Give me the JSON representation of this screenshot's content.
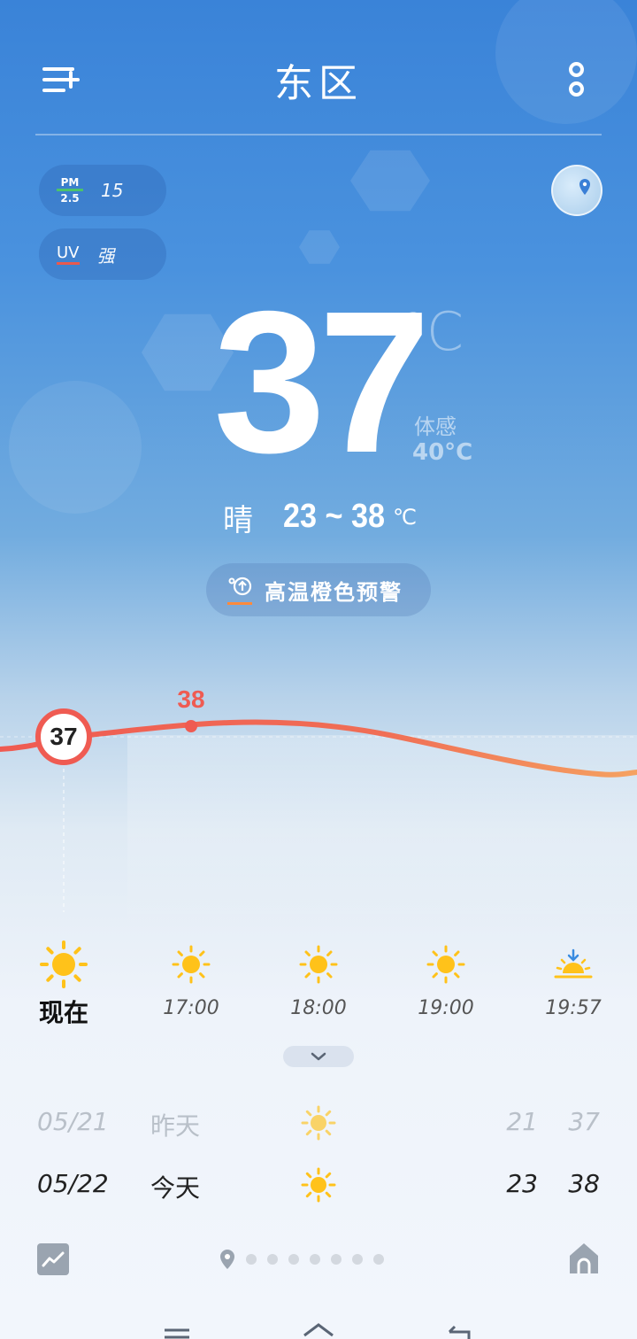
{
  "header": {
    "city": "东区",
    "menu_icon": "add-city-menu-icon",
    "more_icon": "more-options-icon"
  },
  "air": {
    "pm_label_top": "PM",
    "pm_label_bottom": "2.5",
    "pm_value": "15",
    "uv_label": "UV",
    "uv_value": "强"
  },
  "current": {
    "temperature": "37",
    "unit": "°C",
    "feels_like_label": "体感",
    "feels_like_value": "40°C",
    "condition": "晴",
    "range": "23 ~ 38",
    "range_unit": "℃"
  },
  "alert": {
    "text": "高温橙色预警",
    "color": "#ff8a3c"
  },
  "curve": {
    "now_value": "37",
    "max_value": "38",
    "line_color": "#ef5b52"
  },
  "hourly": [
    {
      "time": "现在",
      "icon": "sun-icon"
    },
    {
      "time": "17:00",
      "icon": "sun-icon"
    },
    {
      "time": "18:00",
      "icon": "sun-icon"
    },
    {
      "time": "19:00",
      "icon": "sun-icon"
    },
    {
      "time": "19:57",
      "icon": "sunset-icon"
    }
  ],
  "daily": [
    {
      "date": "05/21",
      "name": "昨天",
      "icon": "sun-icon",
      "low": "21",
      "high": "37"
    },
    {
      "date": "05/22",
      "name": "今天",
      "icon": "sun-icon",
      "low": "23",
      "high": "38"
    }
  ],
  "footer": {
    "trend_icon": "trend-chart-icon",
    "location_icon": "location-pin-icon",
    "home_icon": "home-icon",
    "page_count": 7
  },
  "colors": {
    "sun": "#ffc21a",
    "accent_red": "#ef5b52",
    "sky_top": "#3a83d8"
  }
}
